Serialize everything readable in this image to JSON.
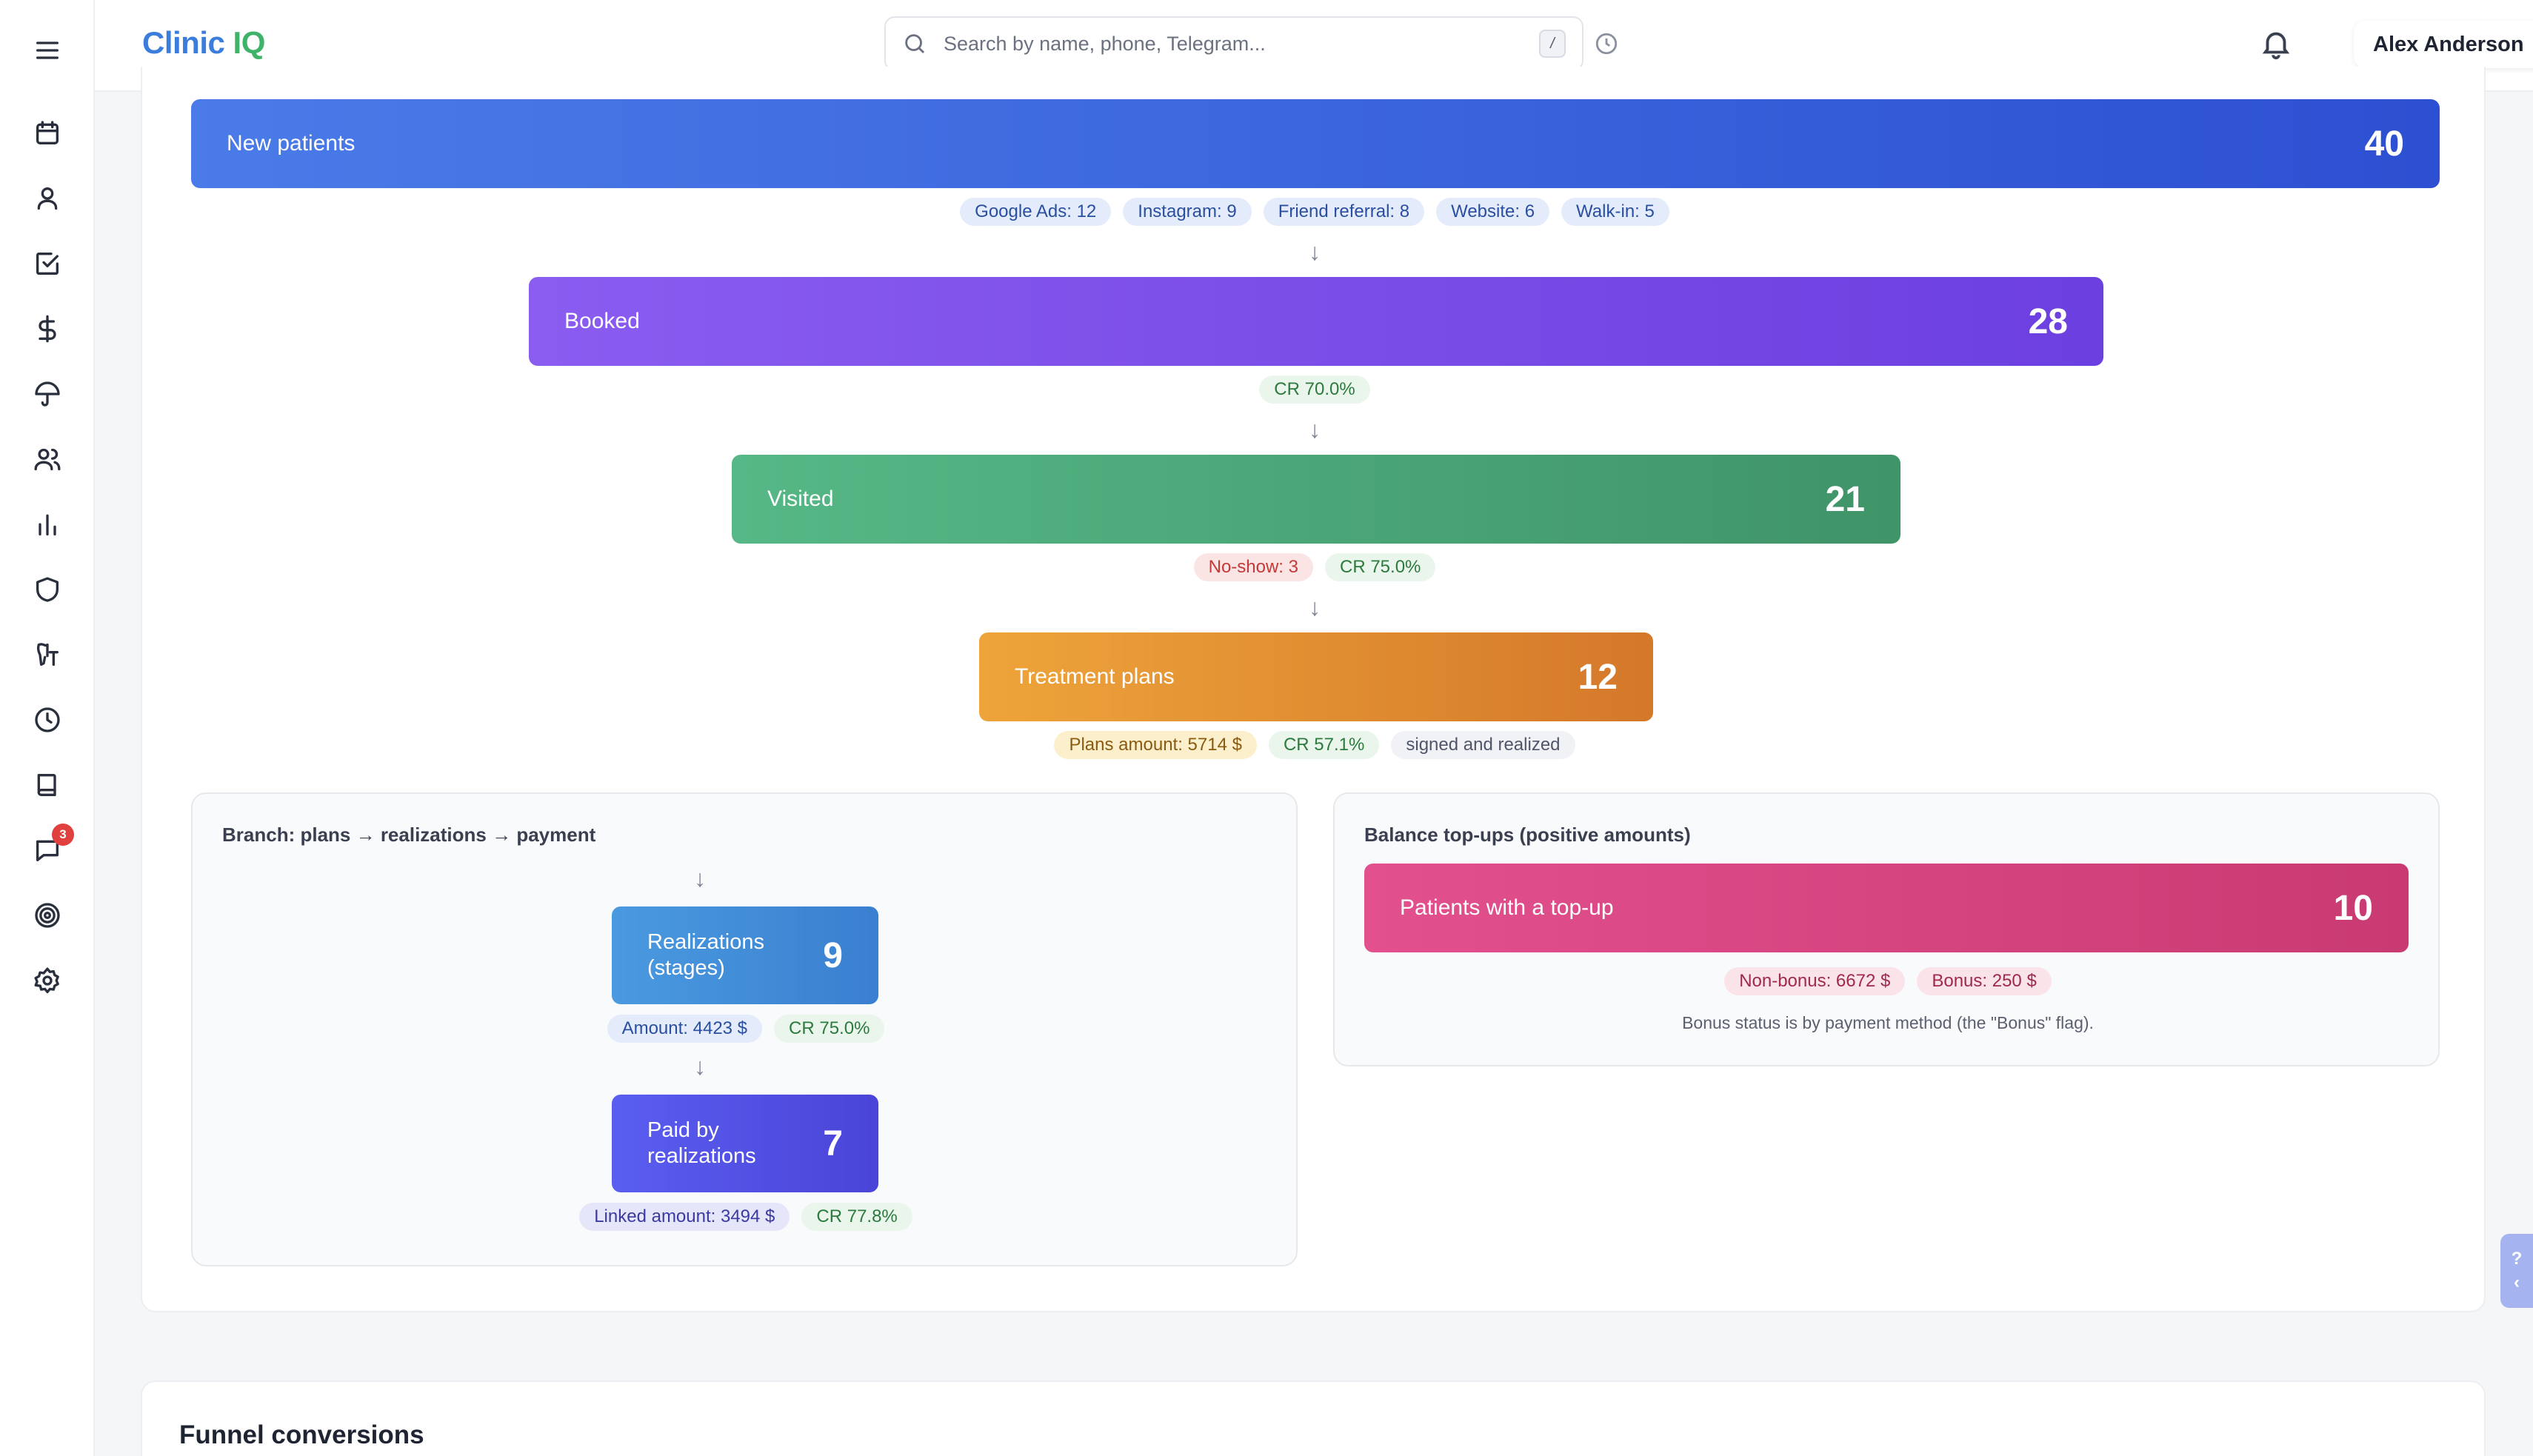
{
  "app": {
    "logo_part1": "Clinic",
    "logo_part2": "IQ"
  },
  "search": {
    "placeholder": "Search by name, phone, Telegram...",
    "shortcut": "/"
  },
  "user": {
    "name": "Alex Anderson"
  },
  "sidebar": {
    "chat_badge": "3",
    "icons": [
      "menu-icon",
      "calendar-icon",
      "user-icon",
      "checkbox-icon",
      "dollar-icon",
      "umbrella-icon",
      "users-icon",
      "bar-chart-icon",
      "shield-icon",
      "tooth-icon",
      "clock-icon",
      "book-icon",
      "chat-icon",
      "target-icon",
      "gear-icon"
    ]
  },
  "funnel": {
    "new_patients": {
      "label": "New patients",
      "value": "40"
    },
    "sources": [
      "Google Ads: 12",
      "Instagram: 9",
      "Friend referral: 8",
      "Website: 6",
      "Walk-in: 5"
    ],
    "booked": {
      "label": "Booked",
      "value": "28",
      "cr": "CR 70.0%"
    },
    "visited": {
      "label": "Visited",
      "value": "21",
      "noshow": "No-show: 3",
      "cr": "CR 75.0%"
    },
    "plans": {
      "label": "Treatment plans",
      "value": "12",
      "amount": "Plans amount: 5714 $",
      "cr": "CR 57.1%",
      "note": "signed and realized"
    }
  },
  "branch": {
    "title": "Branch: plans → realizations → payment",
    "realizations": {
      "label_line1": "Realizations",
      "label_line2": "(stages)",
      "value": "9",
      "amount": "Amount: 4423 $",
      "cr": "CR 75.0%"
    },
    "paid": {
      "label_line1": "Paid by",
      "label_line2": "realizations",
      "value": "7",
      "amount": "Linked amount: 3494 $",
      "cr": "CR 77.8%"
    }
  },
  "topups": {
    "title": "Balance top-ups (positive amounts)",
    "bar": {
      "label": "Patients with a top-up",
      "value": "10"
    },
    "nonbonus": "Non-bonus: 6672 $",
    "bonus": "Bonus: 250 $",
    "note": "Bonus status is by payment method (the \"Bonus\" flag)."
  },
  "help": {
    "label": "?",
    "chevron": "‹"
  },
  "conversions": {
    "title": "Funnel conversions"
  },
  "colors": {
    "new_patients": [
      "#4a7be8",
      "#2d50d2"
    ],
    "booked": [
      "#8a5cf0",
      "#6c3fe0"
    ],
    "visited": [
      "#56b886",
      "#3f9468"
    ],
    "plans": [
      "#eea43a",
      "#d4782a"
    ],
    "realizations": [
      "#4a9ae0",
      "#3a7fd0"
    ],
    "paid": [
      "#5a5ef0",
      "#4a44d8"
    ],
    "topup": [
      "#e2508e",
      "#c93a72"
    ]
  }
}
